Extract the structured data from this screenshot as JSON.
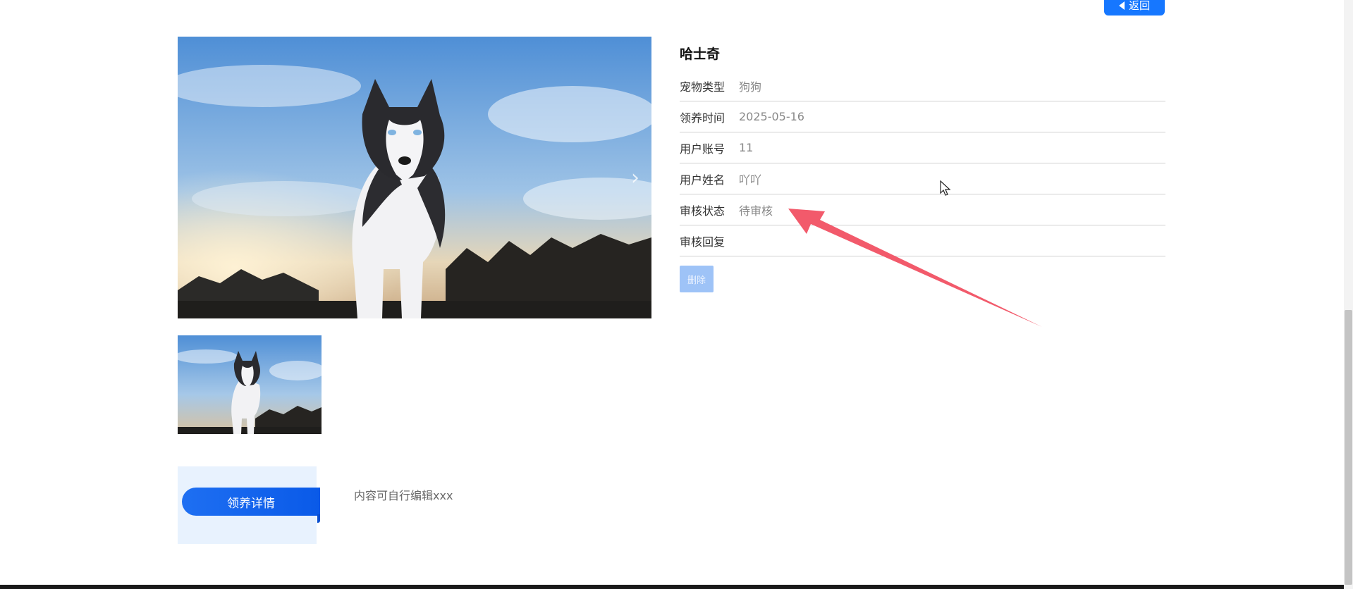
{
  "header": {
    "back_label": "返回"
  },
  "pet": {
    "name": "哈士奇",
    "fields": [
      {
        "label": "宠物类型",
        "value": "狗狗"
      },
      {
        "label": "领养时间",
        "value": "2025-05-16"
      },
      {
        "label": "用户账号",
        "value": "11"
      },
      {
        "label": "用户姓名",
        "value": "吖吖"
      },
      {
        "label": "审核状态",
        "value": "待审核"
      },
      {
        "label": "审核回复",
        "value": ""
      }
    ]
  },
  "actions": {
    "delete_label": "删除"
  },
  "detail": {
    "tab_label": "领养详情",
    "content": "内容可自行编辑xxx"
  },
  "colors": {
    "primary": "#1677ff",
    "delete_bg": "#9ec3f7",
    "annotation": "#f25a6b"
  },
  "icons": {
    "back": "caret-left-icon",
    "next": "chevron-right-icon",
    "cursor": "mouse-pointer-icon"
  }
}
